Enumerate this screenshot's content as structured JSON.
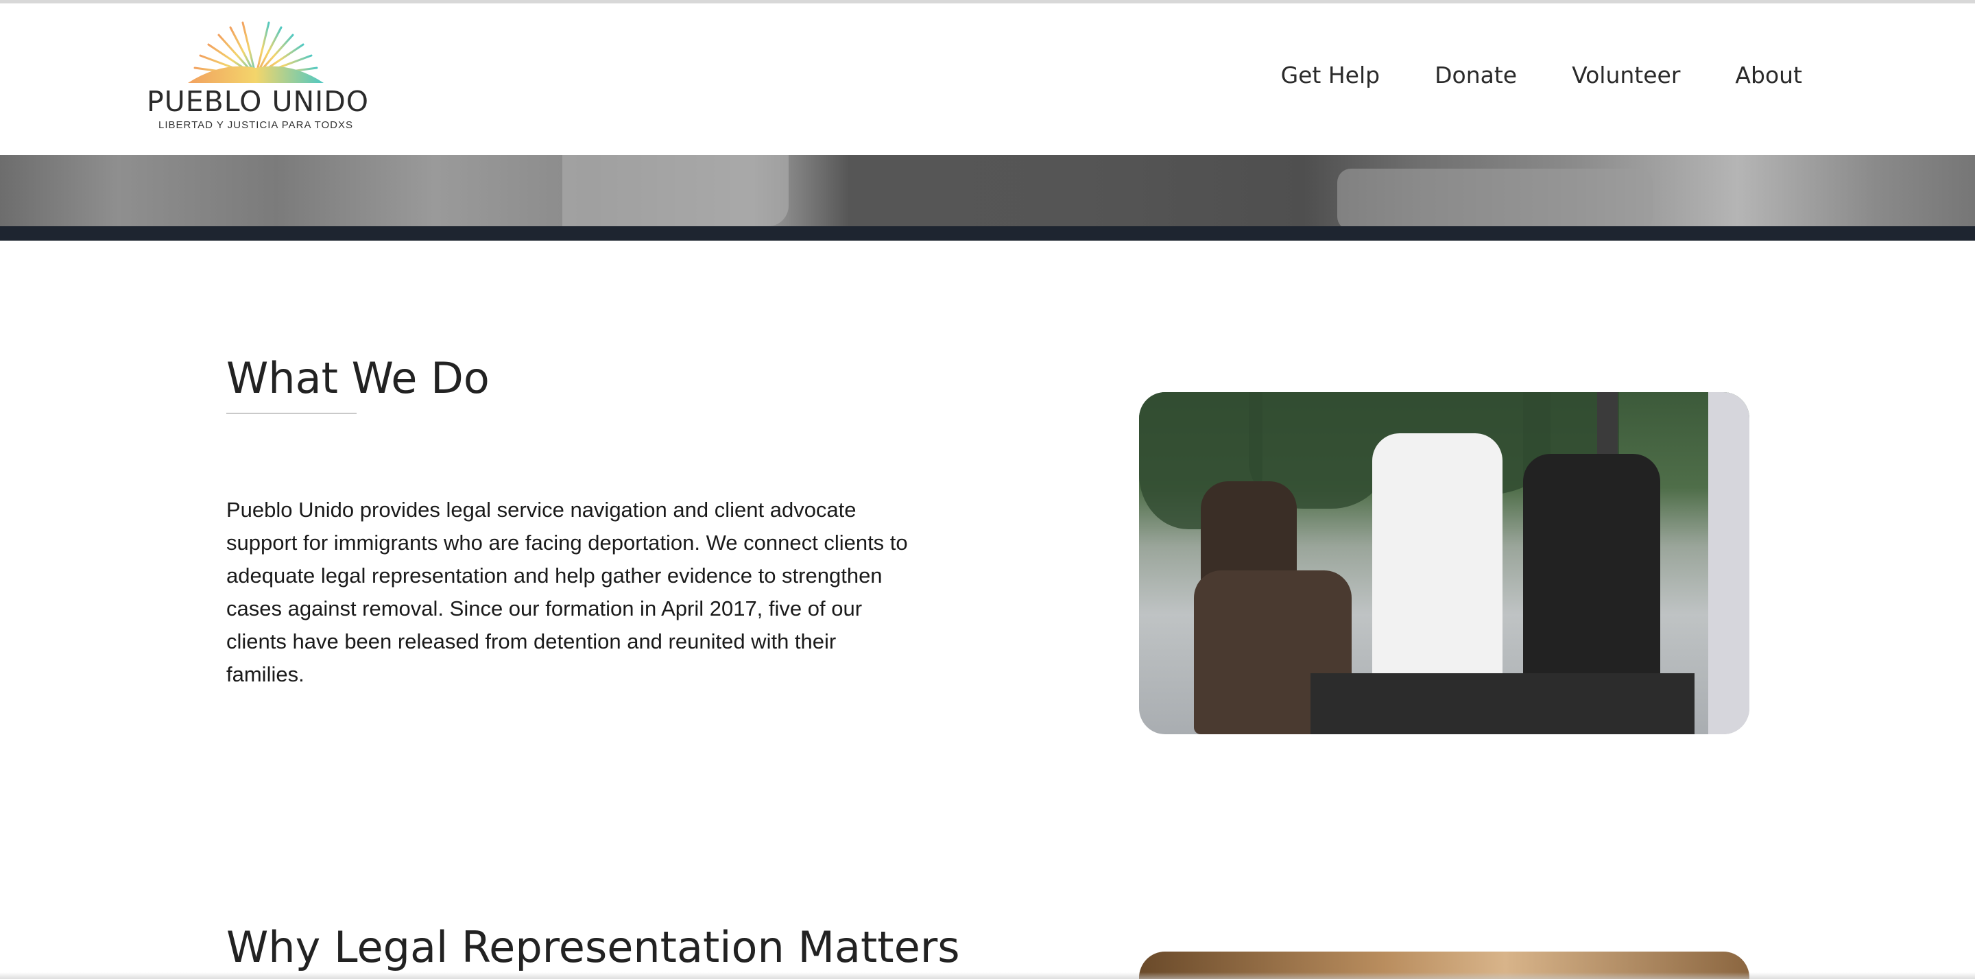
{
  "brand": {
    "name": "PUEBLO UNIDO",
    "tagline": "LIBERTAD Y JUSTICIA PARA TODXS"
  },
  "nav": {
    "items": [
      {
        "label": "Get Help"
      },
      {
        "label": "Donate"
      },
      {
        "label": "Volunteer"
      },
      {
        "label": "About"
      }
    ]
  },
  "sections": {
    "what_we_do": {
      "title": "What We Do",
      "body": "Pueblo Unido provides legal service navigation and client advocate support for immigrants who are facing deportation. We connect clients to adequate legal representation and help gather evidence to strengthen cases against removal. Since our formation in April 2017, five of our clients have been released from detention and reunited with their families."
    },
    "why_legal": {
      "title": "Why Legal Representation Matters"
    }
  },
  "colors": {
    "hero_band": "#1e2530",
    "logo_sun_start": "#f2a15f",
    "logo_sun_mid": "#f3d56b",
    "logo_sun_end": "#4fc8c2"
  }
}
